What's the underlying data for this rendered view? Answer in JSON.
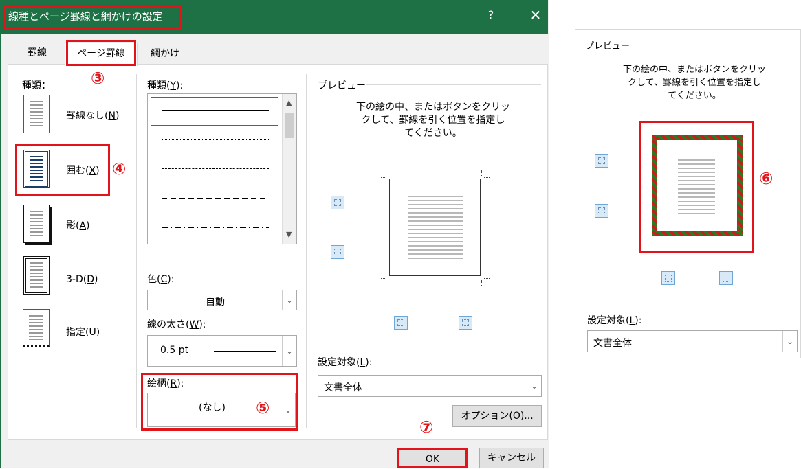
{
  "dialog": {
    "title": "線種とページ罫線と網かけの設定",
    "help": "?",
    "close": "✕",
    "tabs": [
      "罫線",
      "ページ罫線",
      "網かけ"
    ]
  },
  "annotations": [
    "③",
    "④",
    "⑤",
    "⑥",
    "⑦"
  ],
  "setting": {
    "label": "種類：",
    "items": [
      {
        "text": "罫線なし(",
        "key": "N",
        "end": ")"
      },
      {
        "text": "囲む(",
        "key": "X",
        "end": ")"
      },
      {
        "text": "影(",
        "key": "A",
        "end": ")"
      },
      {
        "text": "3-D(",
        "key": "D",
        "end": ")"
      },
      {
        "text": "指定(",
        "key": "U",
        "end": ")"
      }
    ]
  },
  "style": {
    "label": "種類(",
    "key": "Y",
    "end": "):"
  },
  "color": {
    "label": "色(",
    "key": "C",
    "end": "):",
    "value": "自動"
  },
  "width": {
    "label": "線の太さ(",
    "key": "W",
    "end": "):",
    "value": "0.5 pt"
  },
  "art": {
    "label": "絵柄(",
    "key": "R",
    "end": "):",
    "value": "(なし)"
  },
  "preview": {
    "label": "プレビュー",
    "instruction": "下の絵の中、またはボタンをクリック して、罫線を引く位置を指定し てください。",
    "line1": "下の絵の中、またはボタンをクリッ",
    "line2": "クして、罫線を引く位置を指定し",
    "line3": "てください。"
  },
  "apply_to": {
    "label": "設定対象(",
    "key": "L",
    "end": "):",
    "value": "文書全体"
  },
  "buttons": {
    "options_text": "オプション(",
    "options_key": "O",
    "options_end": ")...",
    "ok": "OK",
    "cancel": "キャンセル"
  },
  "right": {
    "label": "プレビュー",
    "line1": "下の絵の中、またはボタンをクリッ",
    "line2": "クして、罫線を引く位置を指定し",
    "line3": "てください。",
    "apply_label": "設定対象(",
    "apply_key": "L",
    "apply_end": "):",
    "apply_value": "文書全体"
  },
  "colors": {
    "titlebar": "#1e7145",
    "highlight": "#e1141a",
    "art_green": "#2e7a1e",
    "art_red": "#c41e1e"
  }
}
